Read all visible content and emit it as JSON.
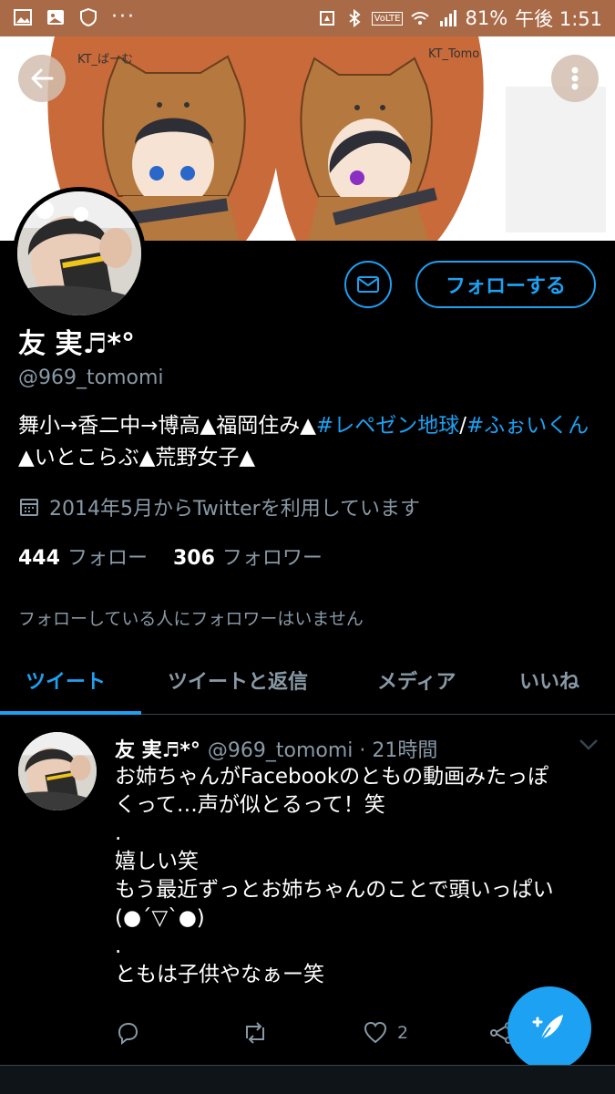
{
  "status_bar": {
    "battery": "81%",
    "time": "午後 1:51",
    "volte": "VoLTE"
  },
  "banner": {
    "left_sign": "KT_ばーむ",
    "right_sign": "KT_Tomo"
  },
  "profile": {
    "display_name": "友 実♬*°",
    "handle": "@969_tomomi",
    "message_icon": "envelope-icon",
    "follow_label": "フォローする",
    "bio_parts": {
      "p1": "舞小→香二中→博高▲福岡住み▲",
      "tag1": "#レペゼン地球",
      "sep": "/",
      "tag2": "#ふぉいくん",
      "p2": "▲いとこらぶ▲荒野女子▲"
    },
    "joined": "2014年5月からTwitterを利用しています",
    "following_count": "444",
    "following_label": "フォロー",
    "followers_count": "306",
    "followers_label": "フォロワー",
    "mutual_note": "フォローしている人にフォロワーはいません"
  },
  "tabs": [
    {
      "label": "ツイート"
    },
    {
      "label": "ツイートと返信"
    },
    {
      "label": "メディア"
    },
    {
      "label": "いいね"
    }
  ],
  "tweet": {
    "name": "友 実♬*°",
    "handle_time": "@969_tomomi · 21時間",
    "text_lines": [
      "お姉ちゃんがFacebookのともの動画みたっぽ",
      "くって…声が似とるって！笑",
      ".",
      "嬉しい笑",
      "もう最近ずっとお姉ちゃんのことで頭いっぱい",
      "(●´▽`●)",
      ".",
      "ともは子供やなぁー笑"
    ],
    "like_count": "2"
  },
  "colors": {
    "accent": "#1da1f2",
    "muted": "#8899a6",
    "status_bar": "#a96a48",
    "banner_orange": "#c86a3a"
  }
}
